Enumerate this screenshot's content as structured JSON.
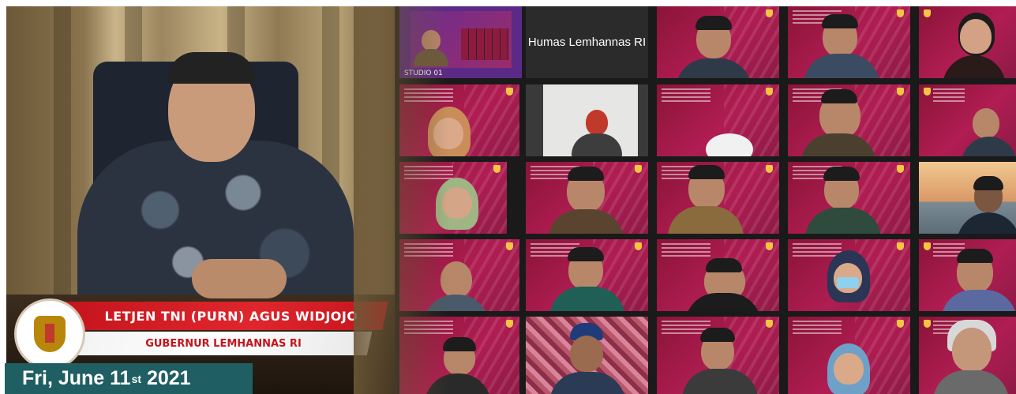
{
  "speaker": {
    "name": "LETJEN TNI (PURN) AGUS WIDJOJO",
    "title": "GUBERNUR LEMHANNAS RI"
  },
  "date": {
    "prefix": "Fri, June 11",
    "suffix": "st",
    "year": " 2021"
  },
  "grid": {
    "studio_label": "STUDIO 01",
    "host_name": "Humas Lemhannas RI"
  },
  "colors": {
    "name_bar": "#e0262d",
    "date_banner": "#1f5e63",
    "tile_bg": "#b01d52"
  }
}
